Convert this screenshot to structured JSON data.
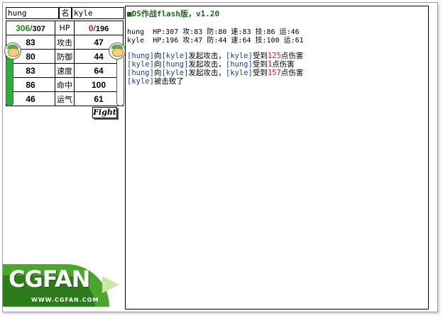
{
  "players": {
    "p1": {
      "name": "hung",
      "hp_current": "306",
      "hp_max": "307",
      "attack": "83",
      "defense": "80",
      "speed": "83",
      "hit": "86",
      "luck": "46"
    },
    "p2": {
      "name": "kyle",
      "hp_current": "0",
      "hp_max": "196",
      "attack": "47",
      "defense": "44",
      "speed": "64",
      "hit": "100",
      "luck": "61"
    }
  },
  "labels": {
    "name": "名",
    "hp": "HP",
    "attack": "攻击",
    "defense": "防御",
    "speed": "速度",
    "hit": "命中",
    "luck": "运气",
    "fight": "Fight",
    "slash": "/"
  },
  "hp_fill": {
    "p1": 0.997,
    "p2": 0.0
  },
  "log": {
    "title": "DS作战flash版，v1.20",
    "stat_lines": [
      "hung  HP:307 攻:83 防:80 速:83 技:86 运:46",
      "kyle  HP:196 攻:47 防:44 速:64 技:100 运:61"
    ],
    "entries": [
      {
        "a": "[hung]",
        "mid": "向",
        "b": "[kyle]",
        "act": "发起攻击，",
        "c": "[kyle]",
        "rec": "受到",
        "dmg": "125",
        "tail": "点伤害"
      },
      {
        "a": "[kyle]",
        "mid": "向",
        "b": "[hung]",
        "act": "发起攻击，",
        "c": "[hung]",
        "rec": "受到",
        "dmg": "1",
        "tail": "点伤害"
      },
      {
        "a": "[hung]",
        "mid": "向",
        "b": "[kyle]",
        "act": "发起攻击，",
        "c": "[kyle]",
        "rec": "受到",
        "dmg": "157",
        "tail": "点伤害"
      }
    ],
    "defeat": {
      "who": "[kyle]",
      "text": "被击败了"
    }
  },
  "logo": {
    "text": "CGFAN",
    "url": "WWW.CGFAN.COM"
  },
  "colors": {
    "hp_green": "#1a8a1a",
    "hp_red": "#d21c1c",
    "gauge_green": "#25b533",
    "title_green": "#1d6a1d",
    "name_blue": "#1b3fa8"
  }
}
